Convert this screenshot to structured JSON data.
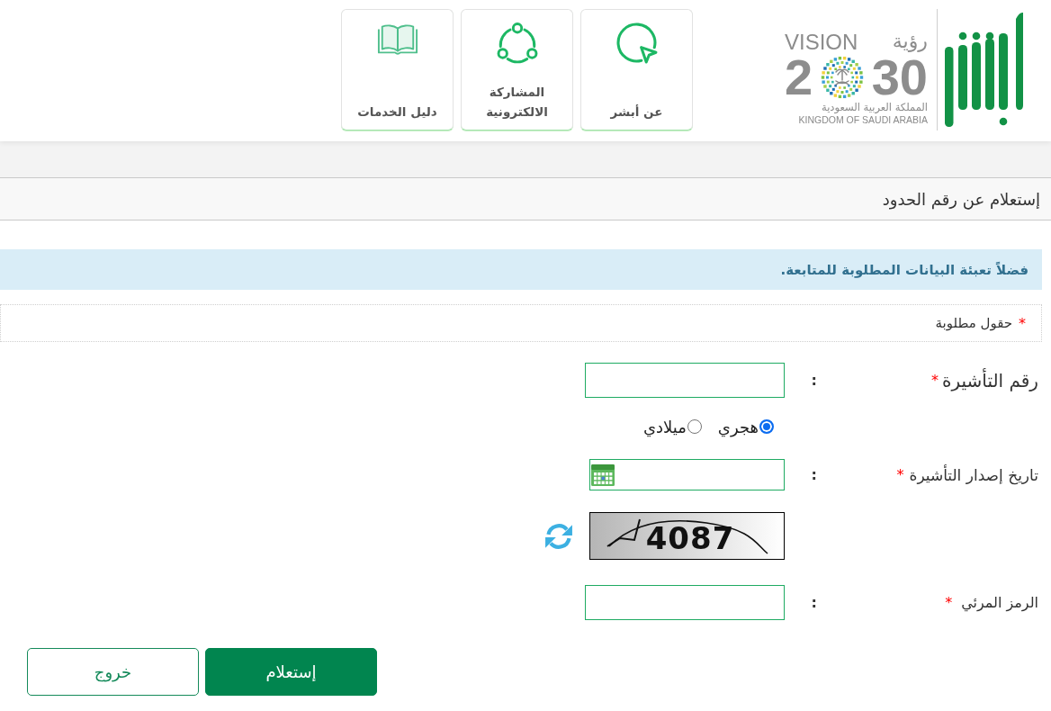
{
  "header": {
    "logo": {
      "vision_ar": "رؤية",
      "vision_en": "VISION",
      "year_start": "2",
      "year_end": "30",
      "country_ar": "المملكة العربية السعودية",
      "country_en": "KINGDOM OF SAUDI ARABIA"
    },
    "nav_cards": [
      {
        "kind": "about",
        "label": "عن أبشر"
      },
      {
        "kind": "participation",
        "label": "المشاركة الالكترونية"
      },
      {
        "kind": "guide",
        "label": "دليل الخدمات"
      }
    ]
  },
  "page_title": "إستعلام عن رقم الحدود",
  "info_message": "فضلاً تعبئة البيانات المطلوبة للمتابعة.",
  "required_note": {
    "mark": "*",
    "text": "حقول مطلوبة"
  },
  "form": {
    "fields": [
      {
        "kind": "text",
        "label": "رقم التأشيرة",
        "required_mark": "*",
        "colon": ":"
      },
      {
        "kind": "radio",
        "options": [
          {
            "label": "هجري",
            "selected": true
          },
          {
            "label": "ميلادي",
            "selected": false
          }
        ]
      },
      {
        "kind": "date",
        "label": "تاريخ إصدار التأشيرة",
        "required_mark": "*",
        "colon": ":"
      },
      {
        "kind": "captcha",
        "text": "4087"
      },
      {
        "kind": "text",
        "label": "الرمز المرئي",
        "required_mark": "*",
        "colon": ":"
      }
    ]
  },
  "buttons": [
    {
      "kind": "primary",
      "label": "إستعلام"
    },
    {
      "kind": "secondary",
      "label": "خروج"
    }
  ]
}
